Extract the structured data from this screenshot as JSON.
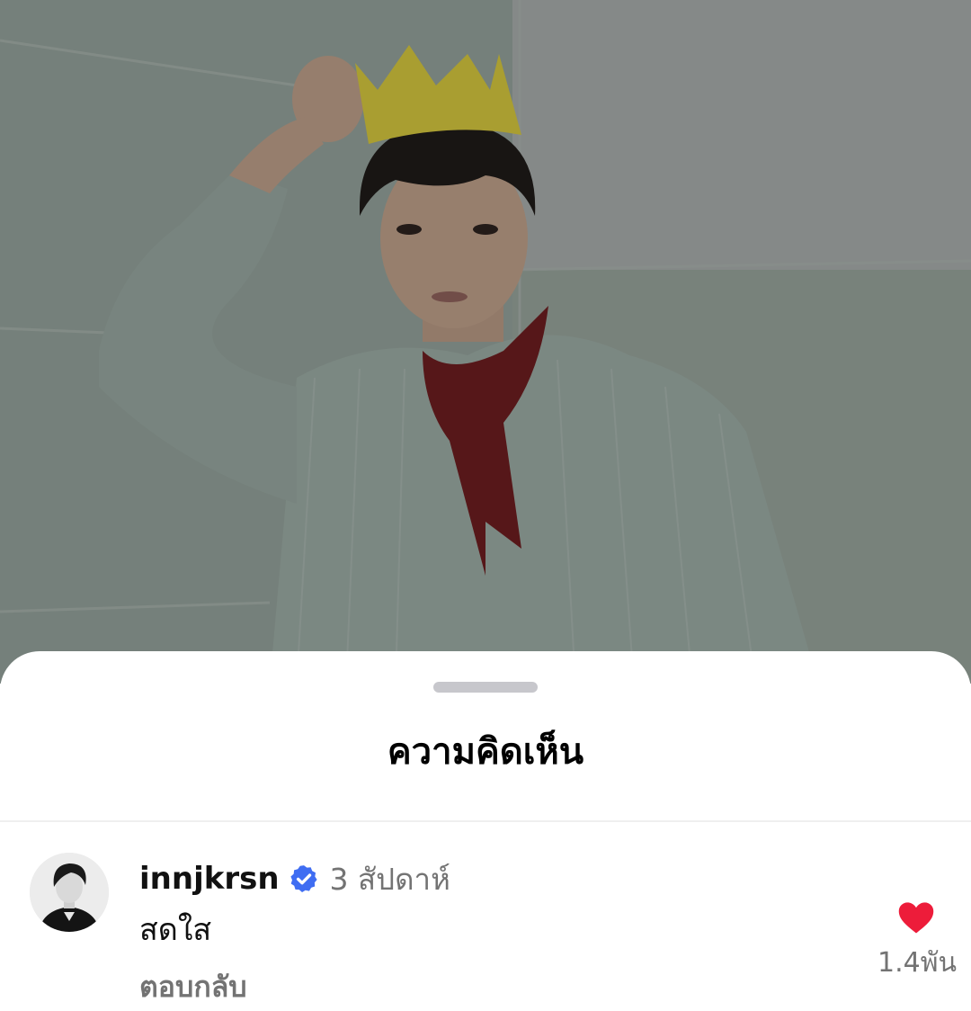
{
  "sheet": {
    "title": "ความคิดเห็น"
  },
  "comment": {
    "username": "innjkrsn",
    "time_ago": "3 สัปดาห์",
    "text": "สดใส",
    "reply_label": "ตอบกลับ",
    "like_count": "1.4พัน",
    "verified": true,
    "liked": true
  },
  "colors": {
    "heart": "#ed1c3a",
    "verified_badge": "#3f6df2",
    "muted_text": "#737373"
  },
  "icons": {
    "verified": "verified-badge-icon",
    "like": "heart-icon"
  }
}
